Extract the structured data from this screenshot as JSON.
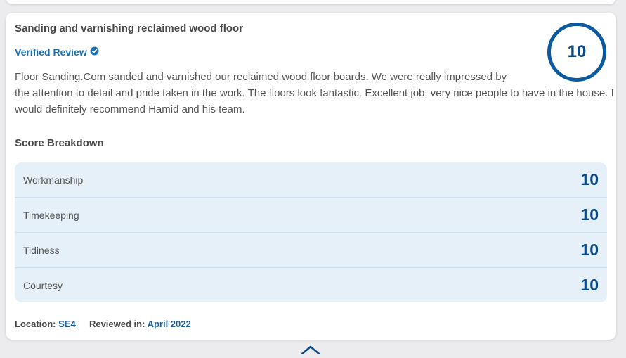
{
  "review": {
    "title": "Sanding and varnishing reclaimed wood floor",
    "verified_label": "Verified Review",
    "overall_score": "10",
    "text_line1": "Floor Sanding.Com sanded and varnished our reclaimed wood floor boards. We were really impressed by",
    "text_rest": "the attention to detail and pride taken in the work. The floors look fantastic. Excellent job, very nice people to have in the house. I would definitely recommend Hamid and his team."
  },
  "breakdown": {
    "heading": "Score Breakdown",
    "rows": [
      {
        "label": "Workmanship",
        "value": "10"
      },
      {
        "label": "Timekeeping",
        "value": "10"
      },
      {
        "label": "Tidiness",
        "value": "10"
      },
      {
        "label": "Courtesy",
        "value": "10"
      }
    ]
  },
  "meta": {
    "location_label": "Location:",
    "location_value": "SE4",
    "reviewed_label": "Reviewed in:",
    "reviewed_value": "April 2022"
  },
  "colors": {
    "accent": "#0b5aa0",
    "breakdown_bg": "#e6f0f9"
  },
  "icons": {
    "verified": "check-badge-icon",
    "scroll_up": "chevron-up-icon"
  }
}
